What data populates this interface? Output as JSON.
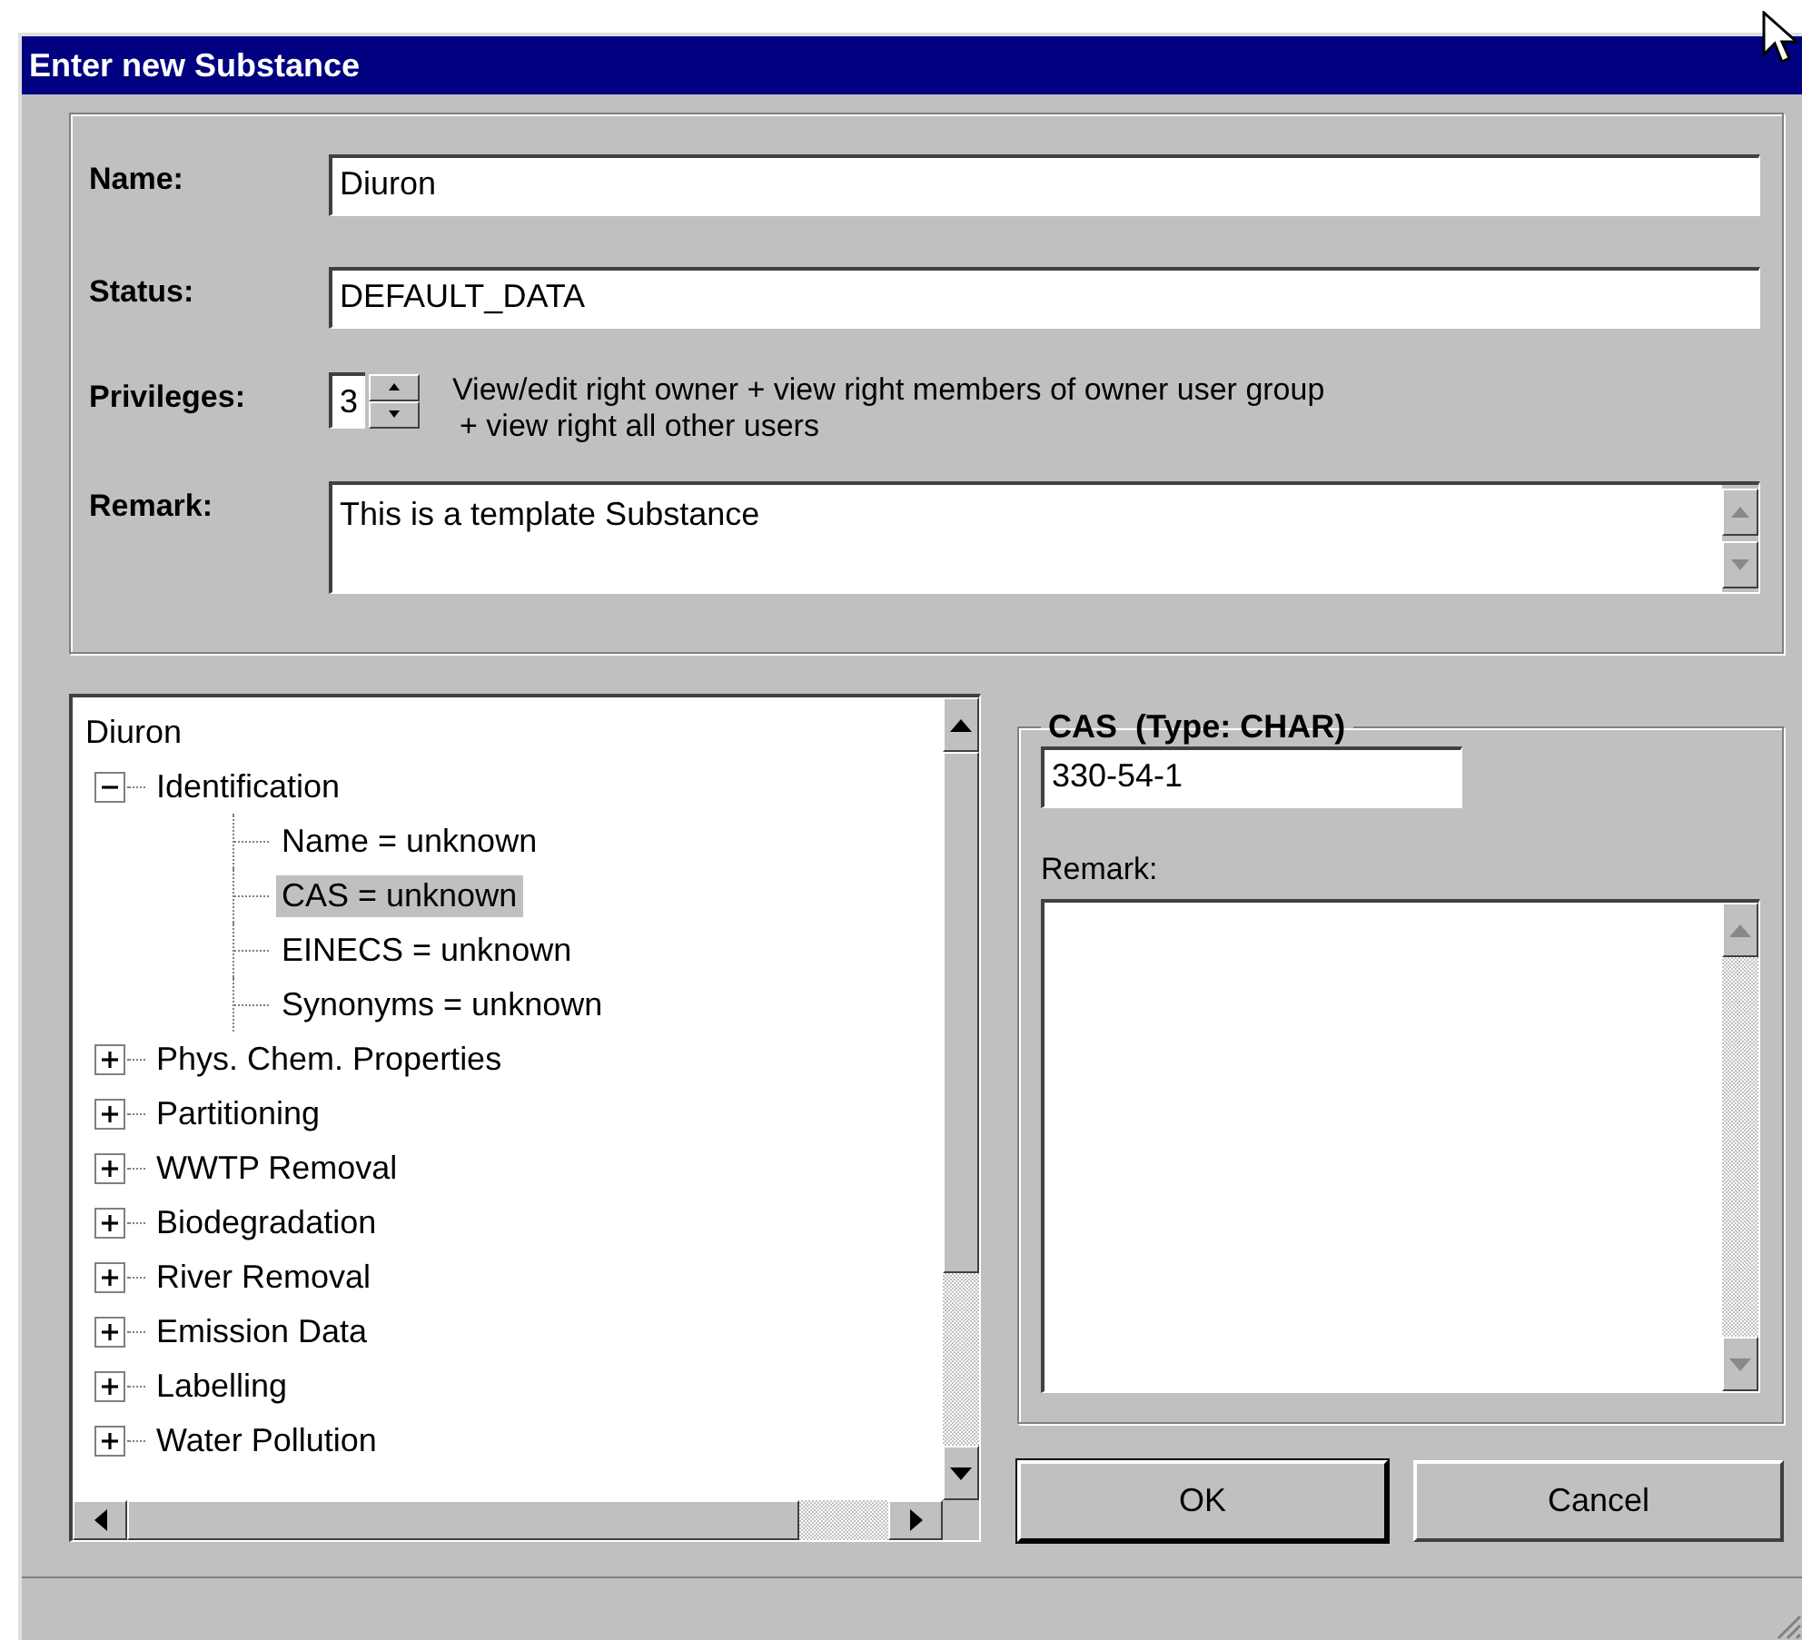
{
  "window": {
    "title": "Enter new Substance"
  },
  "form": {
    "name": {
      "label": "Name:",
      "value": "Diuron"
    },
    "status": {
      "label": "Status:",
      "value": "DEFAULT_DATA"
    },
    "privileges": {
      "label": "Privileges:",
      "value": "3",
      "description_lines": [
        "View/edit right owner + view right members of owner user group",
        "+ view right all other users"
      ]
    },
    "remark": {
      "label": "Remark:",
      "value": "This is a template Substance"
    }
  },
  "tree": {
    "root": {
      "label": "Diuron",
      "selected": false,
      "children": [
        {
          "label": "Identification",
          "expanded": true,
          "selected": false,
          "children": [
            {
              "label": "Name = unknown",
              "selected": false
            },
            {
              "label": "CAS = unknown",
              "selected": true
            },
            {
              "label": "EINECS = unknown",
              "selected": false
            },
            {
              "label": "Synonyms = unknown",
              "selected": false
            }
          ]
        },
        {
          "label": "Phys. Chem. Properties",
          "expanded": false,
          "selected": false
        },
        {
          "label": "Partitioning",
          "expanded": false,
          "selected": false
        },
        {
          "label": "WWTP Removal",
          "expanded": false,
          "selected": false
        },
        {
          "label": "Biodegradation",
          "expanded": false,
          "selected": false
        },
        {
          "label": "River Removal",
          "expanded": false,
          "selected": false
        },
        {
          "label": "Emission Data",
          "expanded": false,
          "selected": false
        },
        {
          "label": "Labelling",
          "expanded": false,
          "selected": false
        },
        {
          "label": "Water Pollution",
          "expanded": false,
          "selected": false
        }
      ]
    }
  },
  "detail": {
    "title": "CAS  (Type: CHAR)",
    "value": "330-54-1",
    "remark_label": "Remark:"
  },
  "buttons": [
    {
      "label": "OK",
      "default": true
    },
    {
      "label": "Cancel",
      "default": false
    }
  ]
}
